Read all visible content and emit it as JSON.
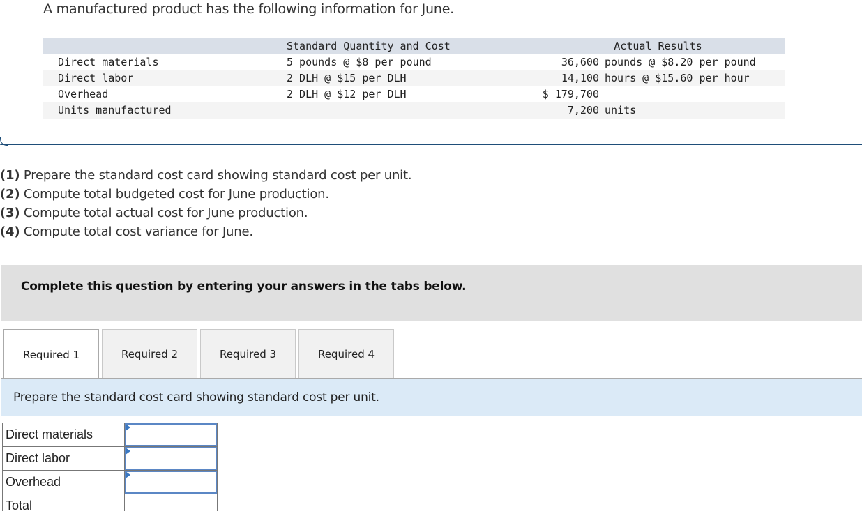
{
  "intro": "A manufactured product has the following information for June.",
  "info_table": {
    "headers": {
      "standard": "Standard Quantity and Cost",
      "actual": "Actual Results"
    },
    "rows": [
      {
        "label": "Direct materials",
        "standard": "5 pounds @ $8 per pound",
        "actual_num": "36,600",
        "actual_txt": "pounds @ $8.20 per pound"
      },
      {
        "label": "Direct labor",
        "standard": "2 DLH @ $15 per DLH",
        "actual_num": "14,100",
        "actual_txt": "hours @ $15.60 per hour"
      },
      {
        "label": "Overhead",
        "standard": "2 DLH @ $12 per DLH",
        "actual_num": "$ 179,700",
        "actual_txt": ""
      },
      {
        "label": "Units manufactured",
        "standard": "",
        "actual_num": "7,200",
        "actual_txt": "units"
      }
    ]
  },
  "requirements": [
    {
      "num": "(1)",
      "text": " Prepare the standard cost card showing standard cost per unit."
    },
    {
      "num": "(2)",
      "text": " Compute total budgeted cost for June production."
    },
    {
      "num": "(3)",
      "text": " Compute total actual cost for June production."
    },
    {
      "num": "(4)",
      "text": " Compute total cost variance for June."
    }
  ],
  "instruction": "Complete this question by entering your answers in the tabs below.",
  "tabs": [
    {
      "label": "Required 1",
      "active": true
    },
    {
      "label": "Required 2",
      "active": false
    },
    {
      "label": "Required 3",
      "active": false
    },
    {
      "label": "Required 4",
      "active": false
    }
  ],
  "prompt": "Prepare the standard cost card showing standard cost per unit.",
  "answer_table": {
    "rows": [
      {
        "label": "Direct materials",
        "value": ""
      },
      {
        "label": "Direct labor",
        "value": ""
      },
      {
        "label": "Overhead",
        "value": ""
      },
      {
        "label": "Total",
        "value": ""
      }
    ]
  }
}
